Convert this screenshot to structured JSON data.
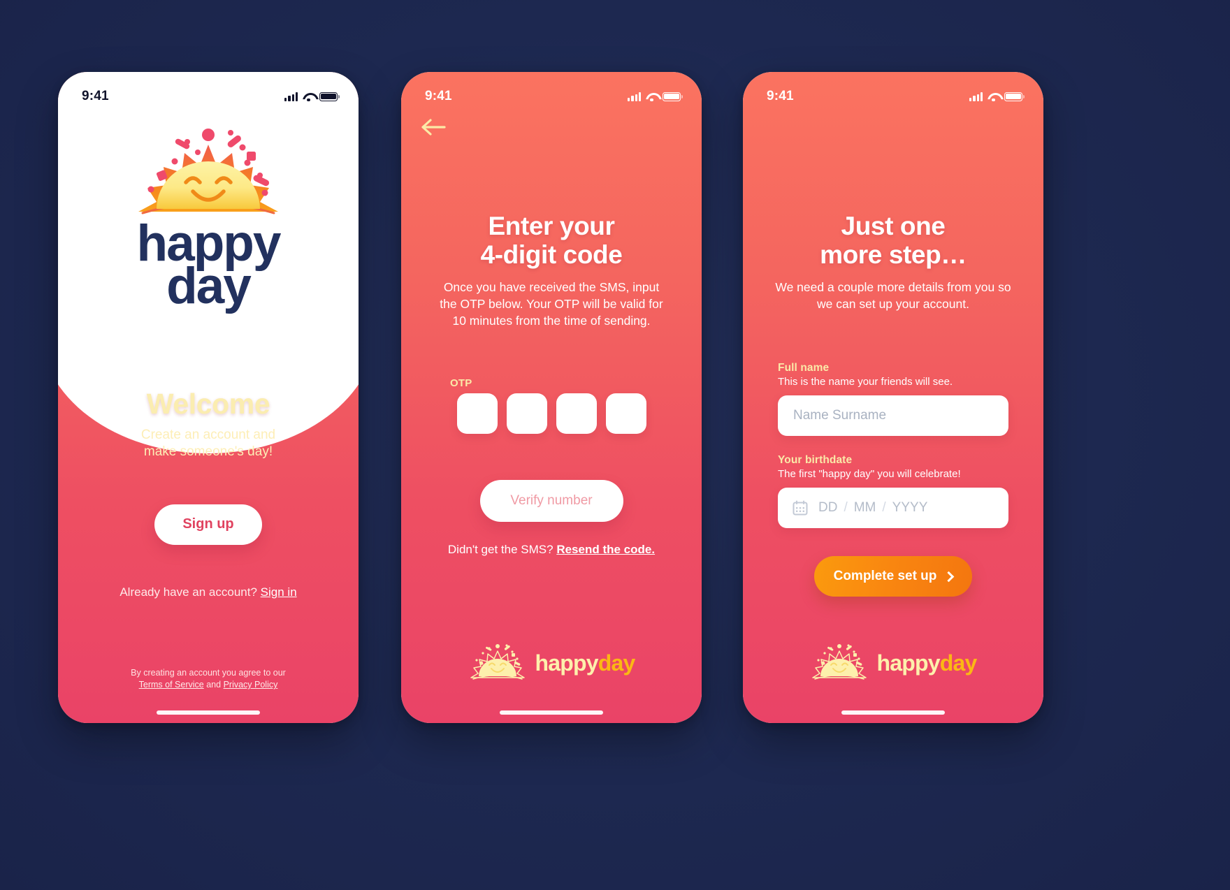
{
  "brand": {
    "name_line1": "happy",
    "name_line2": "day",
    "footer_happy": "happy",
    "footer_day": "day",
    "logo_icon": "sun-smiling-icon",
    "navy": "#22315e",
    "coral_top": "#fb7360",
    "coral_bottom": "#ea4367",
    "cream": "#fbedb0",
    "orange": "#f98610"
  },
  "status_bar": {
    "time": "9:41",
    "signal_icon": "cellular-signal-icon",
    "wifi_icon": "wifi-icon",
    "battery_icon": "battery-full-icon"
  },
  "screen_welcome": {
    "title": "Welcome",
    "subtitle_line1": "Create an account and",
    "subtitle_line2": "make someone's day!",
    "signup_button": "Sign up",
    "account_prompt": "Already have an account?",
    "signin_link": "Sign in",
    "terms_line1": "By creating an account you agree to our",
    "terms_service": "Terms of Service",
    "terms_and": "and",
    "terms_privacy": "Privacy Policy"
  },
  "screen_otp": {
    "back_icon": "arrow-left-icon",
    "title_line1": "Enter your",
    "title_line2": "4-digit code",
    "description": "Once you have received the SMS, input the OTP below. Your OTP will be valid for 10 minutes from the time of sending.",
    "otp_label": "OTP",
    "otp_digits": [
      "",
      "",
      "",
      ""
    ],
    "verify_button": "Verify number",
    "resend_prompt": "Didn't get the SMS?",
    "resend_link": "Resend the code."
  },
  "screen_details": {
    "title_line1": "Just one",
    "title_line2": "more step…",
    "description": "We need a couple more details from you so we can set up your account.",
    "fullname_label": "Full name",
    "fullname_hint": "This is the name your friends will see.",
    "fullname_placeholder": "Name Surname",
    "fullname_value": "",
    "birthdate_label": "Your birthdate",
    "birthdate_hint": "The first \"happy day\" you will celebrate!",
    "calendar_icon": "calendar-icon",
    "date_dd": "DD",
    "date_sep1": "/",
    "date_mm": "MM",
    "date_sep2": "/",
    "date_yyyy": "YYYY",
    "submit_button": "Complete set up",
    "submit_icon": "chevron-right-icon"
  }
}
